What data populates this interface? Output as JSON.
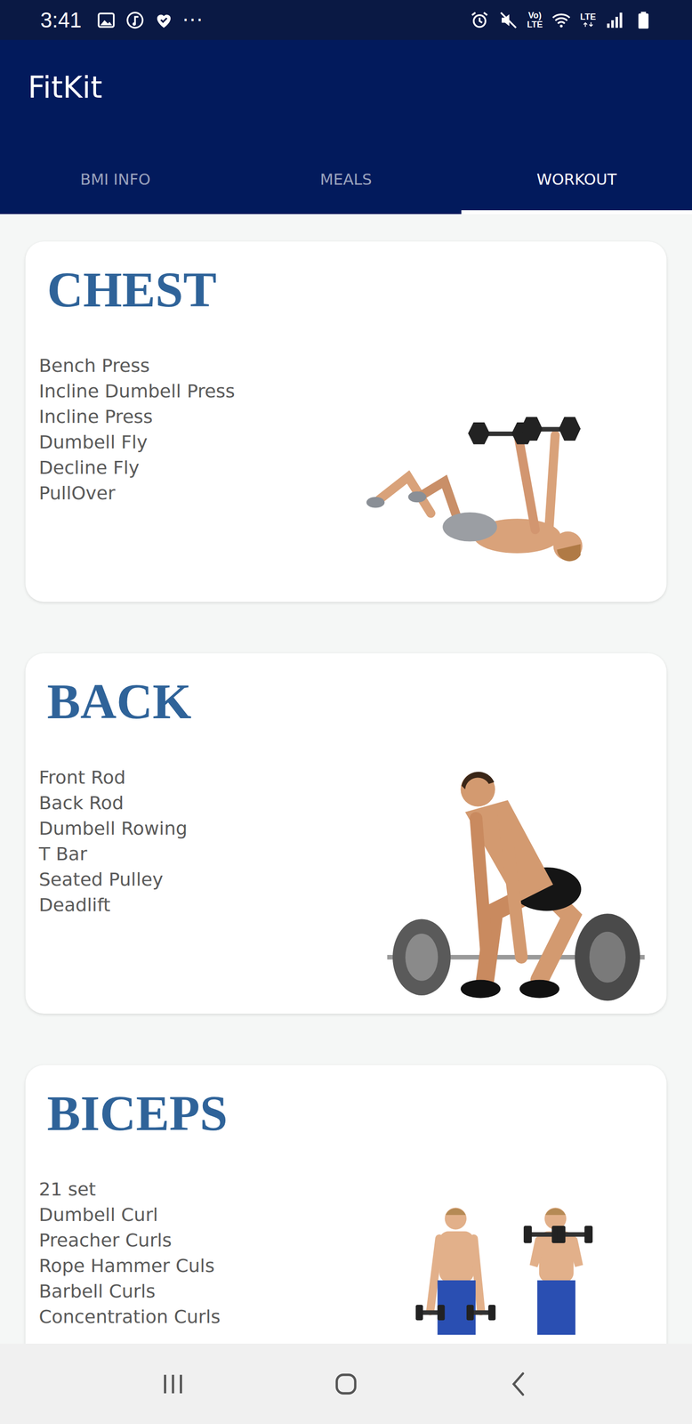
{
  "status_bar": {
    "time": "3:41",
    "more": "···",
    "volte_top": "Vo)",
    "volte_bottom": "LTE",
    "network": "LTE"
  },
  "app": {
    "title": "FitKit"
  },
  "tabs": [
    {
      "label": "BMI INFO",
      "selected": false
    },
    {
      "label": "MEALS",
      "selected": false
    },
    {
      "label": "WORKOUT",
      "selected": true
    }
  ],
  "cards": [
    {
      "title": "CHEST",
      "kind": "bench",
      "exercises": [
        "Bench Press",
        "Incline Dumbell Press",
        "Incline Press",
        "Dumbell Fly",
        "Decline Fly",
        "PullOver"
      ]
    },
    {
      "title": "BACK",
      "kind": "deadlift",
      "exercises": [
        "Front Rod",
        "Back Rod",
        "Dumbell Rowing",
        "T Bar",
        "Seated Pulley",
        "Deadlift"
      ]
    },
    {
      "title": "BICEPS",
      "kind": "curl",
      "exercises": [
        "21 set",
        "Dumbell Curl",
        "Preacher Curls",
        "Rope Hammer Culs",
        "Barbell Curls",
        "Concentration Curls"
      ]
    }
  ]
}
